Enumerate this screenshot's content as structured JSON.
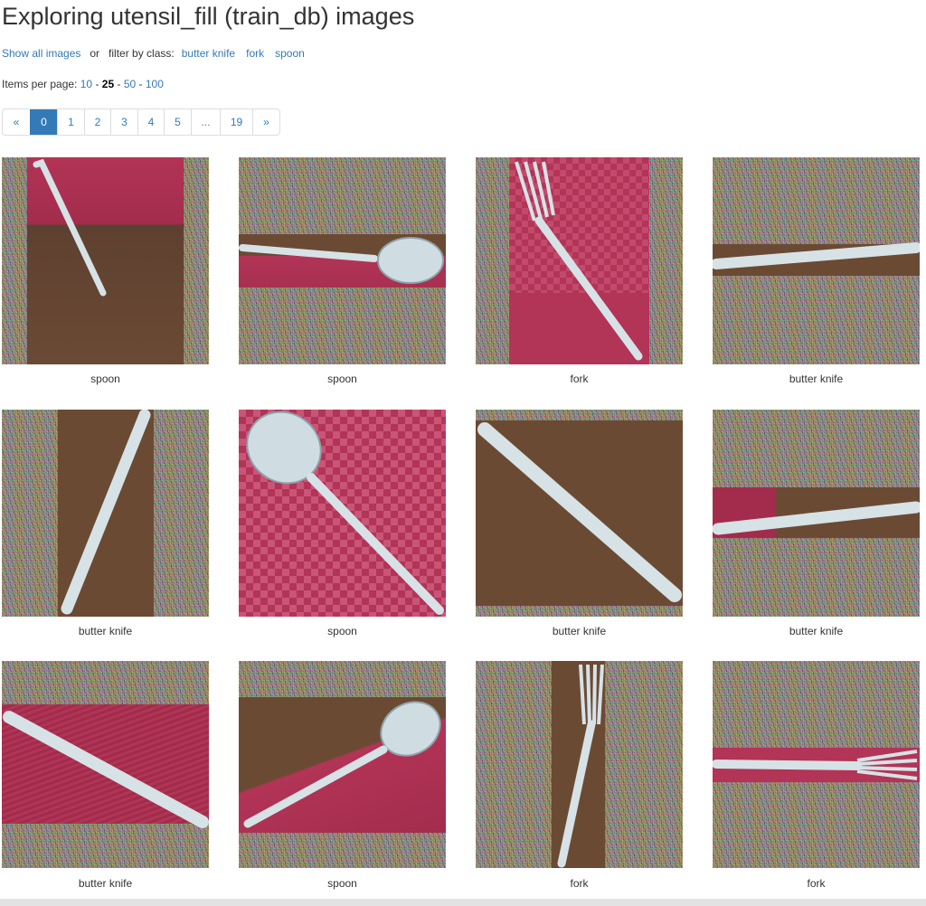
{
  "page": {
    "title": "Exploring utensil_fill (train_db) images"
  },
  "filter": {
    "show_all": "Show all images",
    "or": "or",
    "filter_label": "filter by class:",
    "classes": [
      "butter knife",
      "fork",
      "spoon"
    ]
  },
  "per_page": {
    "label": "Items per page:",
    "options": [
      "10",
      "25",
      "50",
      "100"
    ],
    "selected": "25",
    "sep": "-"
  },
  "pagination": {
    "prev": "«",
    "pages": [
      "0",
      "1",
      "2",
      "3",
      "4",
      "5"
    ],
    "ellipsis": "...",
    "last": "19",
    "next": "»",
    "active": "0"
  },
  "colors": {
    "link": "#337ab7",
    "active_page_bg": "#337ab7",
    "cloth_red": "#b23456",
    "table_wood": "#6b4a34",
    "metal": "#d6e2e6"
  },
  "gallery": {
    "items": [
      {
        "label": "spoon",
        "utensil": "spoon",
        "background": "red-cloth"
      },
      {
        "label": "spoon",
        "utensil": "spoon",
        "background": "red-cloth-strip"
      },
      {
        "label": "fork",
        "utensil": "fork",
        "background": "red-checker"
      },
      {
        "label": "butter knife",
        "utensil": "butter knife",
        "background": "wood-strip"
      },
      {
        "label": "butter knife",
        "utensil": "butter knife",
        "background": "wood"
      },
      {
        "label": "spoon",
        "utensil": "spoon",
        "background": "red-checker"
      },
      {
        "label": "butter knife",
        "utensil": "butter knife",
        "background": "wood"
      },
      {
        "label": "butter knife",
        "utensil": "butter knife",
        "background": "wood-strip"
      },
      {
        "label": "butter knife",
        "utensil": "butter knife",
        "background": "red-cloth"
      },
      {
        "label": "spoon",
        "utensil": "spoon",
        "background": "wood-red"
      },
      {
        "label": "fork",
        "utensil": "fork",
        "background": "wood"
      },
      {
        "label": "fork",
        "utensil": "fork",
        "background": "red-cloth-strip"
      }
    ]
  }
}
